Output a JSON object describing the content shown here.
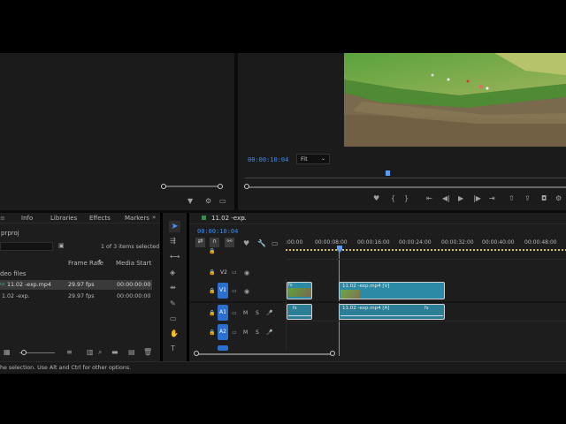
{
  "source_monitor": {
    "filter_icon": "funnel-icon",
    "wrench_icon": "wrench-icon"
  },
  "program_monitor": {
    "timecode": "00:00:10:04",
    "zoom": "Fit",
    "controls": [
      "marker-icon",
      "in-point-icon",
      "out-point-icon",
      "go-to-in-icon",
      "step-back-icon",
      "play-icon",
      "step-forward-icon",
      "go-to-out-icon",
      "lift-icon",
      "extract-icon",
      "export-frame-icon",
      "settings-icon"
    ]
  },
  "project_panel": {
    "tabs": [
      "Info",
      "Libraries",
      "Effects",
      "Markers"
    ],
    "project_name": "prproj",
    "selection_status": "1 of 3 items selected",
    "columns": {
      "frame_rate": "Frame Rate",
      "media_start": "Media Start"
    },
    "folder": "deo files",
    "rows": [
      {
        "name": "11.02 -exp.mp4",
        "frame_rate": "29.97 fps",
        "media_start": "00:00:00:00",
        "selected": true
      },
      {
        "name": "1.02 -exp.",
        "frame_rate": "29.97 fps",
        "media_start": "00:00:00:00",
        "selected": false
      }
    ]
  },
  "timeline": {
    "sequence_name": "11.02 -exp.",
    "timecode": "00:00:10:04",
    "ruler": [
      ":00:00",
      "00:00:08:00",
      "00:00:16:00",
      "00:00:24:00",
      "00:00:32:00",
      "00:00:40:00",
      "00:00:48:00"
    ],
    "tracks": [
      {
        "label": "V2",
        "kind": "video",
        "active": false
      },
      {
        "label": "V1",
        "kind": "video",
        "active": true
      },
      {
        "label": "A1",
        "kind": "audio",
        "active": true
      },
      {
        "label": "A2",
        "kind": "audio",
        "active": true
      }
    ],
    "clips": {
      "video_main": "11.02 -exp.mp4 [V]",
      "audio_main": "11.02 -exp.mp4 [A]",
      "audio_mark": "fx",
      "video_fx_badge": "fx"
    },
    "track_letters": {
      "mute": "M",
      "solo": "S"
    }
  },
  "status_bar": {
    "text": "he selection. Use Alt and Ctrl for other options."
  },
  "colors": {
    "accent": "#2b6fd1",
    "clip_video": "#2b8ba6",
    "clip_audio": "#2a7f96",
    "timecode": "#3d8df5",
    "playhead": "#5c9cf8"
  }
}
